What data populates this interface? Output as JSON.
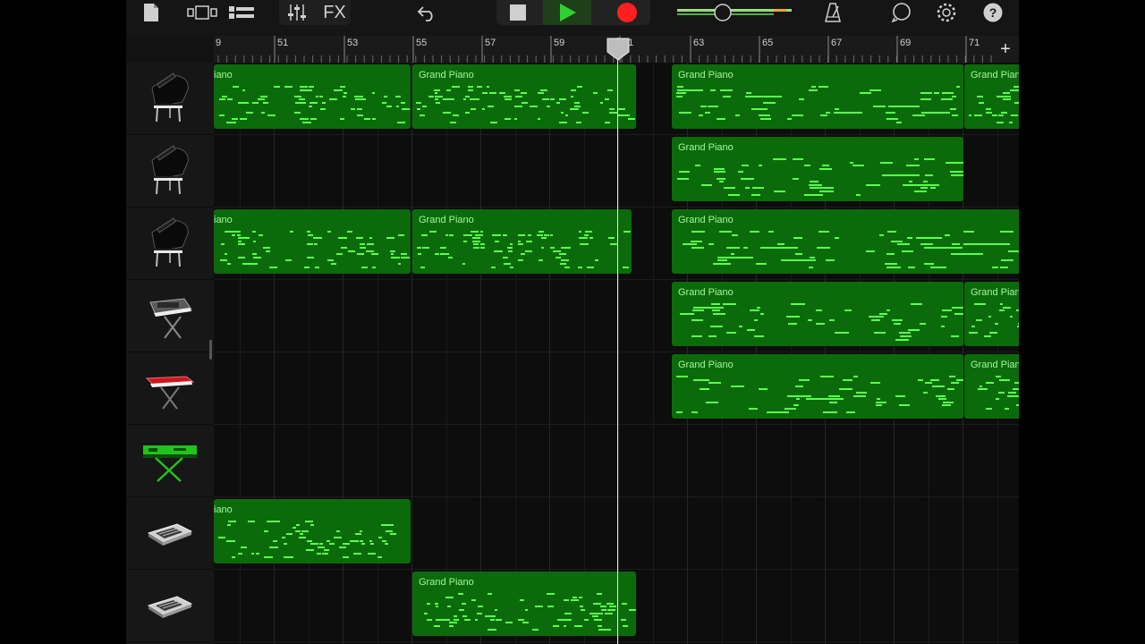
{
  "toolbar": {
    "fx_label": "FX",
    "colors": {
      "play": "#2fd12f",
      "record": "#ff1f1f",
      "accent_green": "#5cff4f"
    }
  },
  "ruler": {
    "bar_numbers": [
      "9",
      "51",
      "53",
      "55",
      "57",
      "59",
      "61",
      "63",
      "65",
      "67",
      "69",
      "71"
    ],
    "add_label": "+"
  },
  "tracks": [
    {
      "instrument": "grand-piano-icon",
      "regions": [
        {
          "name": "iano"
        },
        {
          "name": "Grand Piano"
        },
        {
          "name": "Grand Piano"
        },
        {
          "name": "Grand Pian"
        }
      ]
    },
    {
      "instrument": "grand-piano-icon",
      "regions": [
        {
          "name": "Grand Piano"
        }
      ]
    },
    {
      "instrument": "grand-piano-icon",
      "regions": [
        {
          "name": "iano"
        },
        {
          "name": "Grand Piano"
        },
        {
          "name": "Grand Piano"
        }
      ]
    },
    {
      "instrument": "synth-keyboard-icon",
      "regions": [
        {
          "name": "Grand Piano"
        },
        {
          "name": "Grand Pian"
        }
      ]
    },
    {
      "instrument": "red-keyboard-icon",
      "regions": [
        {
          "name": "Grand Piano"
        },
        {
          "name": "Grand Pian"
        }
      ]
    },
    {
      "instrument": "green-keyboard-stand-icon",
      "regions": []
    },
    {
      "instrument": "drum-machine-icon",
      "regions": [
        {
          "name": "iano"
        }
      ]
    },
    {
      "instrument": "drum-machine-icon",
      "regions": [
        {
          "name": "Grand Piano"
        }
      ]
    }
  ]
}
